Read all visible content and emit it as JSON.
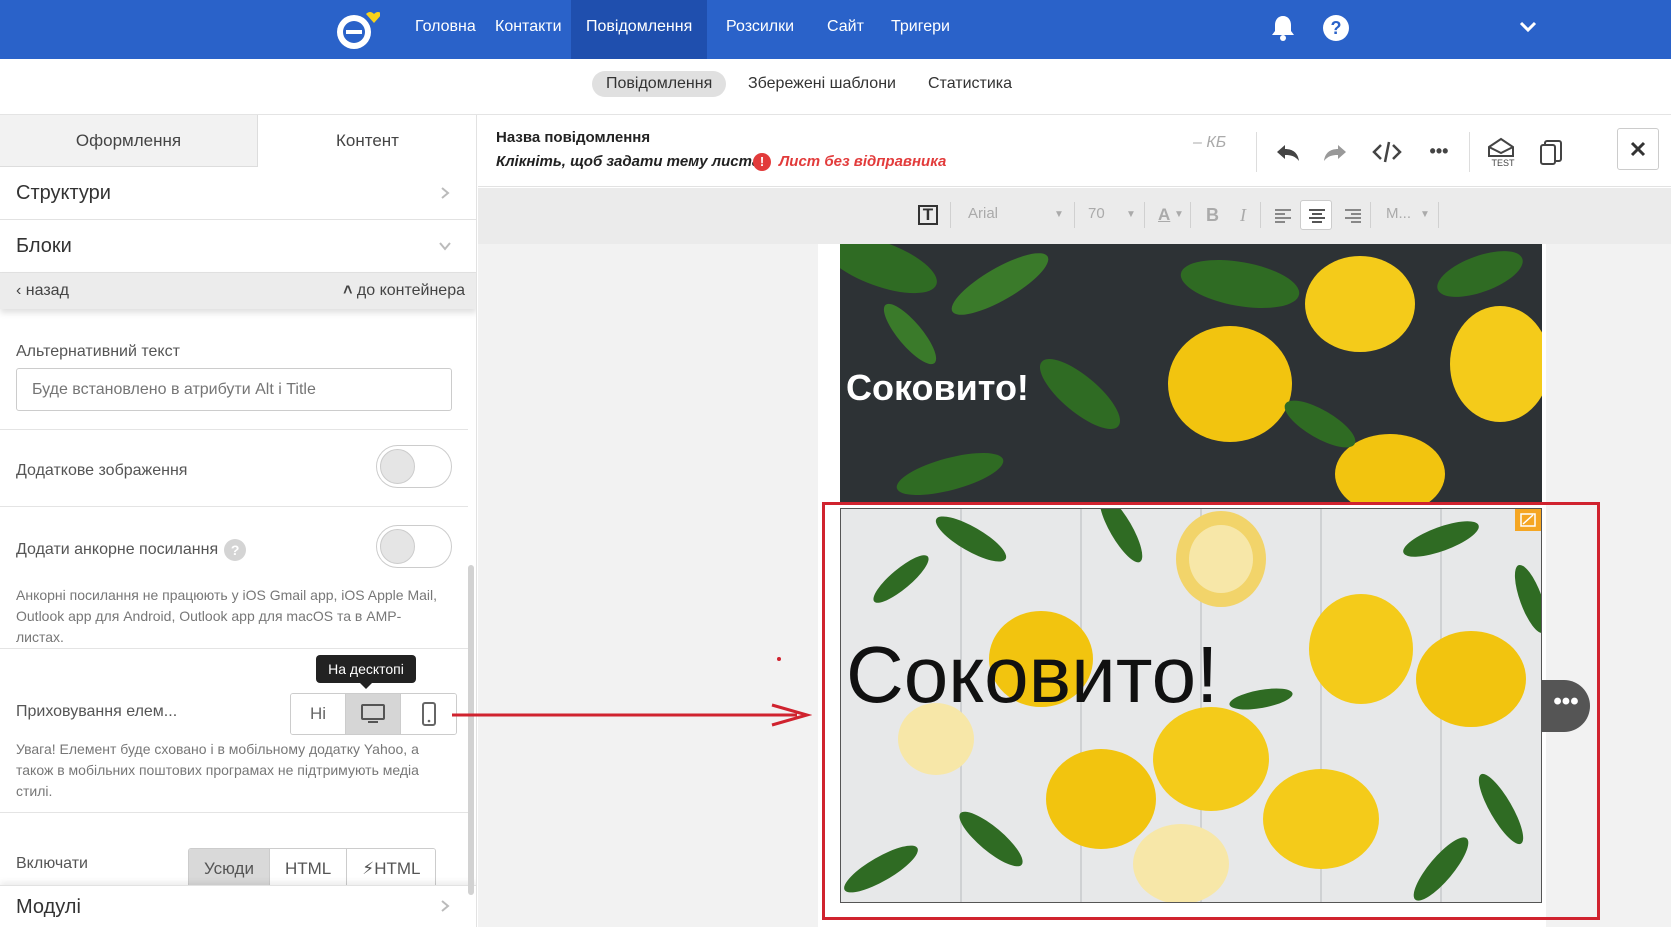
{
  "nav": {
    "items": [
      "Головна",
      "Контакти",
      "Повідомлення",
      "Розсилки",
      "Сайт",
      "Тригери"
    ],
    "active_index": 2
  },
  "subnav": {
    "items": [
      "Повідомлення",
      "Збережені шаблони",
      "Статистика"
    ],
    "active_index": 0
  },
  "sidebar": {
    "tabs": [
      "Оформлення",
      "Контент"
    ],
    "active_tab": 1,
    "structures": "Структури",
    "blocks": "Блоки",
    "back": "назад",
    "to_container": "до контейнера",
    "alt_label": "Альтернативний текст",
    "alt_placeholder": "Буде встановлено в атрибути Alt і Title",
    "extra_image_label": "Додаткове зображення",
    "anchor_label": "Додати анкорне посилання",
    "anchor_note": "Анкорні посилання не працюють у iOS Gmail app, iOS Apple Mail, Outlook app для Android, Outlook app для macOS та в AMP-листах.",
    "tooltip": "На десктопі",
    "hide_label": "Приховування елем...",
    "hide_options": [
      "Ні"
    ],
    "hide_note": "Увага! Елемент буде сховано і в мобільному додатку Yahoo, а також в мобільних поштових програмах не підтримують медіа стилі.",
    "include_label": "Включати",
    "include_options": [
      "Усюди",
      "HTML",
      "HTML"
    ],
    "modules": "Модулі"
  },
  "editor": {
    "message_name": "Назва повідомлення",
    "subject_hint": "Клікніть, щоб задати тему листа",
    "warning_icon": "!",
    "warning": "Лист без відправника",
    "size": "– КБ",
    "test_label": "TEST",
    "more_dots": "•••",
    "toolbar": {
      "font": "Arial",
      "size": "70",
      "more": "M..."
    },
    "image1_text": "Соковито!",
    "image2_text": "Соковито!"
  },
  "colors": {
    "brand": "#2a62c9",
    "accent_red": "#d0232f",
    "warning": "#e23b3b",
    "lemon": "#f2c40f",
    "leaf": "#2f6b23"
  }
}
